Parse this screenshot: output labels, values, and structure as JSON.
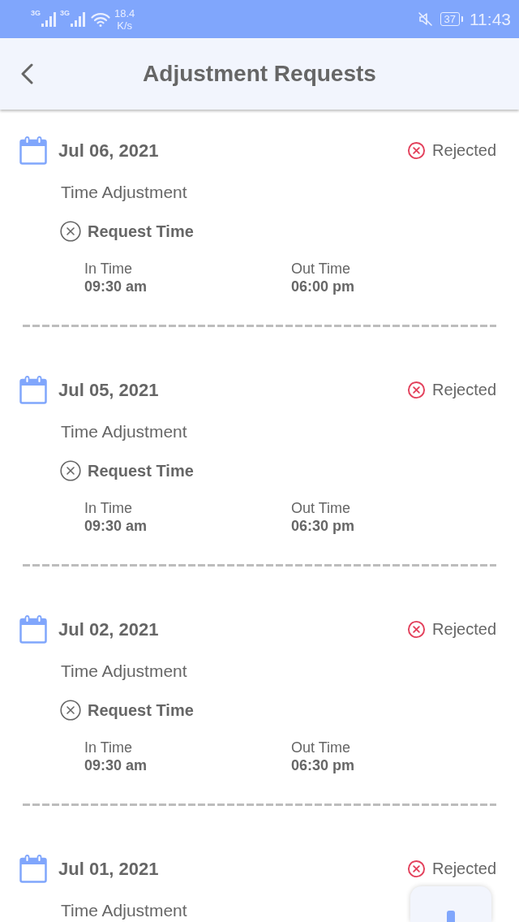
{
  "status_bar": {
    "networks": [
      {
        "label": "3G"
      },
      {
        "label": "3G"
      }
    ],
    "speed": "18.4",
    "speed_unit": "K/s",
    "battery": "37",
    "time": "11:43"
  },
  "header": {
    "title": "Adjustment Requests"
  },
  "requests": [
    {
      "date": "Jul 06, 2021",
      "status": {
        "label": "Rejected",
        "kind": "rejected"
      },
      "type": "Time Adjustment",
      "section": "Request Time",
      "in_label": "In Time",
      "in_value": "09:30 am",
      "out_label": "Out Time",
      "out_value": "06:00 pm"
    },
    {
      "date": "Jul 05, 2021",
      "status": {
        "label": "Rejected",
        "kind": "rejected"
      },
      "type": "Time Adjustment",
      "section": "Request Time",
      "in_label": "In Time",
      "in_value": "09:30 am",
      "out_label": "Out Time",
      "out_value": "06:30 pm"
    },
    {
      "date": "Jul 02, 2021",
      "status": {
        "label": "Rejected",
        "kind": "rejected"
      },
      "type": "Time Adjustment",
      "section": "Request Time",
      "in_label": "In Time",
      "in_value": "09:30 am",
      "out_label": "Out Time",
      "out_value": "06:30 pm"
    },
    {
      "date": "Jul 01, 2021",
      "status": {
        "label": "Rejected",
        "kind": "rejected"
      },
      "type": "Time Adjustment"
    }
  ]
}
